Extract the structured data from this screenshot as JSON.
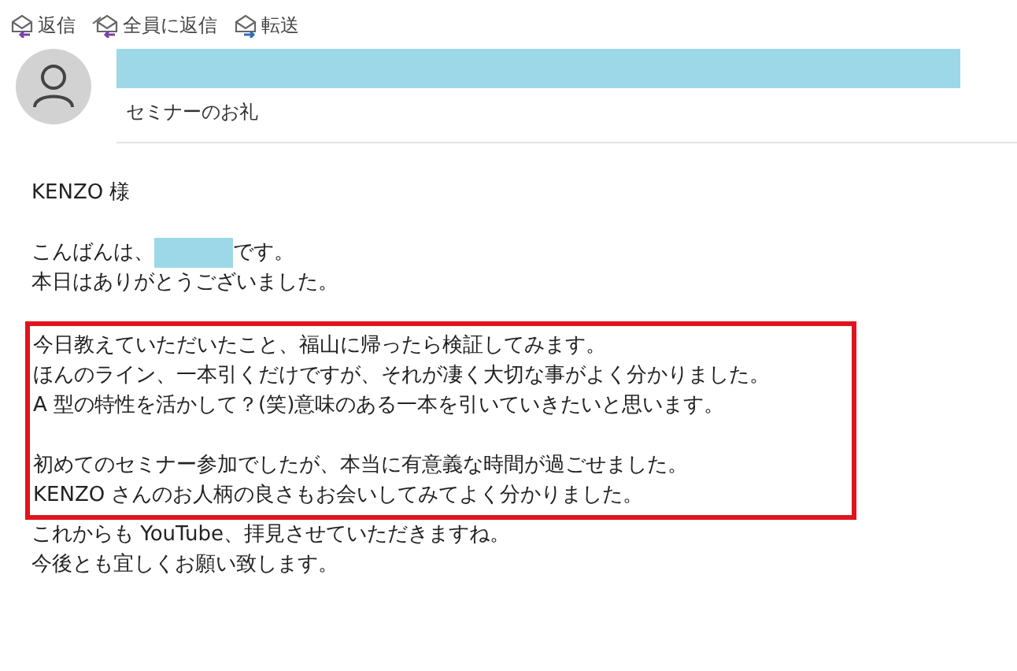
{
  "toolbar": [
    {
      "kind": "reply",
      "label": "返信"
    },
    {
      "kind": "reply_all",
      "label": "全員に返信"
    },
    {
      "kind": "forward",
      "label": "転送"
    }
  ],
  "header": {
    "subject": "セミナーのお礼"
  },
  "body": {
    "salutation": "KENZO 様",
    "greeting": {
      "before": "こんばんは、",
      "after": "です。"
    },
    "intro": [
      "本日はありがとうございました。"
    ],
    "highlight": {
      "paragraphs": [
        [
          "今日教えていただいたこと、福山に帰ったら検証してみます。",
          "ほんのライン、一本引くだけですが、それが凄く大切な事がよく分かりました。",
          "A 型の特性を活かして？(笑)意味のある一本を引いていきたいと思います。"
        ],
        [
          "初めてのセミナー参加でしたが、本当に有意義な時間が過ごせました。",
          "KENZO さんのお人柄の良さもお会いしてみてよく分かりました。"
        ]
      ]
    },
    "closing": [
      "これからも YouTube、拝見させていただきますね。",
      "今後とも宜しくお願い致します。"
    ]
  }
}
